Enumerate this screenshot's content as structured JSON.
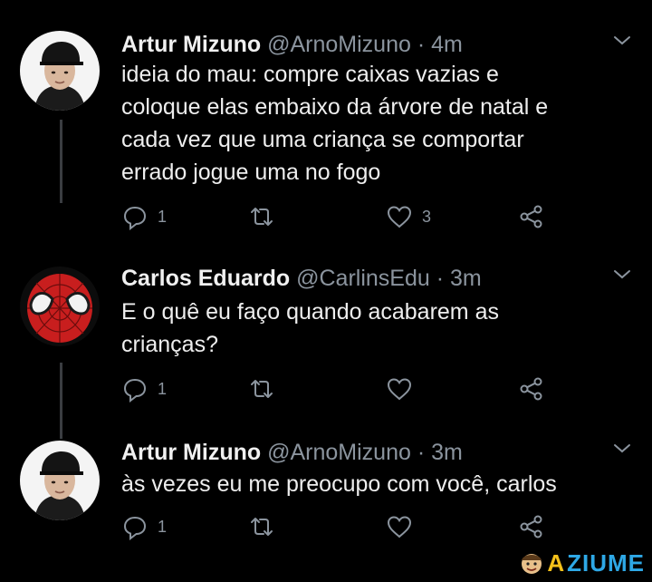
{
  "tweets": [
    {
      "name": "Artur Mizuno",
      "handle": "@ArnoMizuno",
      "sep": "·",
      "time": "4m",
      "lines": [
        "ideia do mau: compre caixas vazias e",
        "coloque elas embaixo da árvore de natal e",
        "cada vez que uma criança se comportar",
        "errado jogue uma no fogo"
      ],
      "replies": "1",
      "retweets": "",
      "likes": "3"
    },
    {
      "name": "Carlos Eduardo",
      "handle": "@CarlinsEdu",
      "sep": "·",
      "time": "3m",
      "lines": [
        "E o quê eu faço quando acabarem as",
        "crianças?"
      ],
      "replies": "1",
      "retweets": "",
      "likes": ""
    },
    {
      "name": "Artur Mizuno",
      "handle": "@ArnoMizuno",
      "sep": "·",
      "time": "3m",
      "lines": [
        "às vezes eu me preocupo com você, carlos"
      ],
      "replies": "1",
      "retweets": "",
      "likes": ""
    }
  ],
  "watermark": {
    "first": "A",
    "rest": "ZIUME"
  },
  "icons": {
    "reply": "reply-icon",
    "retweet": "retweet-icon",
    "like": "heart-icon",
    "share": "share-icon",
    "more": "chevron-down-icon"
  },
  "colors": {
    "background": "#000000",
    "text": "#e7e9ea",
    "muted": "#8b949e",
    "watermark_yellow": "#f5c11a",
    "watermark_blue": "#2ea8e6"
  }
}
